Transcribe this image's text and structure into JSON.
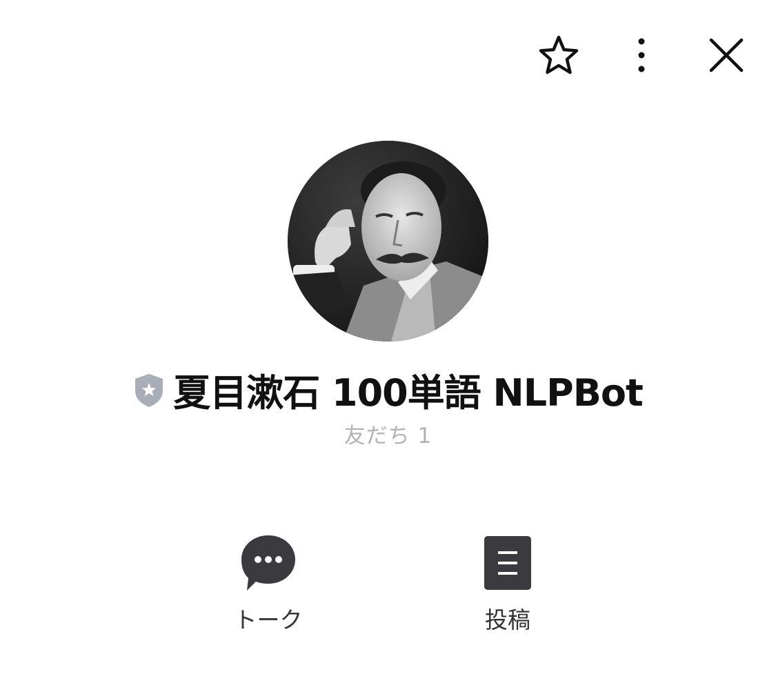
{
  "header": {
    "icons": [
      "star-icon",
      "more-vertical-icon",
      "close-icon"
    ]
  },
  "profile": {
    "name": "夏目漱石 100単語 NLPBot",
    "badge_icon": "shield-star-icon",
    "friends_text": "友だち 1"
  },
  "actions": [
    {
      "label": "トーク",
      "icon": "chat-bubble-icon"
    },
    {
      "label": "投稿",
      "icon": "post-document-icon"
    }
  ],
  "colors": {
    "icon_dark": "#3a3a3f",
    "badge_gray": "#a9aeb6",
    "subtext": "#b3b3b3"
  }
}
